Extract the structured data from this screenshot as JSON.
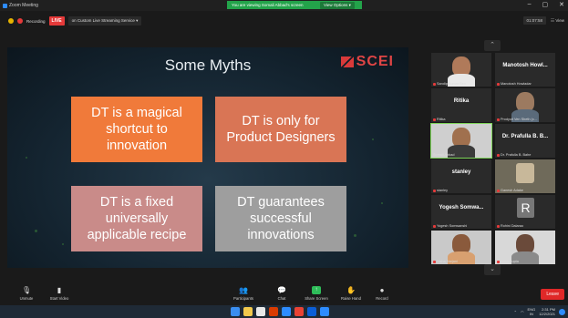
{
  "window": {
    "title": "Zoom Meeting"
  },
  "banner": {
    "message": "You are viewing Somali Abbad's screen",
    "options": "View Options ▾"
  },
  "window_controls": {
    "minimize": "–",
    "maximize": "▢",
    "close": "✕"
  },
  "status": {
    "recording": "Recording",
    "live": "LIVE",
    "stream": "on Custom Live Streaming Service ▾",
    "timer": "01:07:58",
    "view": "☷ View"
  },
  "slide": {
    "title": "Some Myths",
    "logo_text": "SCEI",
    "boxes": [
      {
        "text": "DT is a magical shortcut to innovation"
      },
      {
        "text": "DT is only for Product Designers"
      },
      {
        "text": "DT is a fixed universally applicable recipe"
      },
      {
        "text": "DT guarantees successful innovations"
      }
    ]
  },
  "pager": {
    "up": "⌃",
    "down": "⌄"
  },
  "participants": [
    {
      "label": "Sandip Kumar Sen",
      "big": ""
    },
    {
      "label": "Manotosh Howladar",
      "big": "Manotosh Howl..."
    },
    {
      "label": "Ritika",
      "big": "Ritika"
    },
    {
      "label": "Prodyuit Ven Sheth (c...",
      "big": ""
    },
    {
      "label": "Somali Abbad",
      "big": ""
    },
    {
      "label": "Dr. Prafulla B. Bahe",
      "big": "Dr. Prafulla B. B..."
    },
    {
      "label": "stanley",
      "big": "stanley"
    },
    {
      "label": "Ganesh Adake",
      "big": ""
    },
    {
      "label": "Yogesh Somwanshi",
      "big": "Yogesh Somwa..."
    },
    {
      "label": "Rohini Dalarao",
      "big": ""
    },
    {
      "label": "Nisha Harjani",
      "big": ""
    },
    {
      "label": "Aalia Gupta",
      "big": ""
    }
  ],
  "avatar_letter": "R",
  "toolbar": {
    "unmute": "Unmute",
    "start_video": "Start Video",
    "participants": "Participants",
    "participants_count": "24",
    "chat": "Chat",
    "share": "Share Screen",
    "raise": "Raise Hand",
    "record": "Record",
    "leave": "Leave"
  },
  "taskbar": {
    "lang": "ENG",
    "region": "IN",
    "time": "2:31 PM",
    "date": "12/2/2021"
  },
  "colors": {
    "box1": "#f07a3a",
    "box2": "#d97555",
    "box3": "#c98b89",
    "box4": "#9e9e9e",
    "banner": "#23a34a",
    "live": "#e53a3a",
    "leave": "#e02828"
  }
}
